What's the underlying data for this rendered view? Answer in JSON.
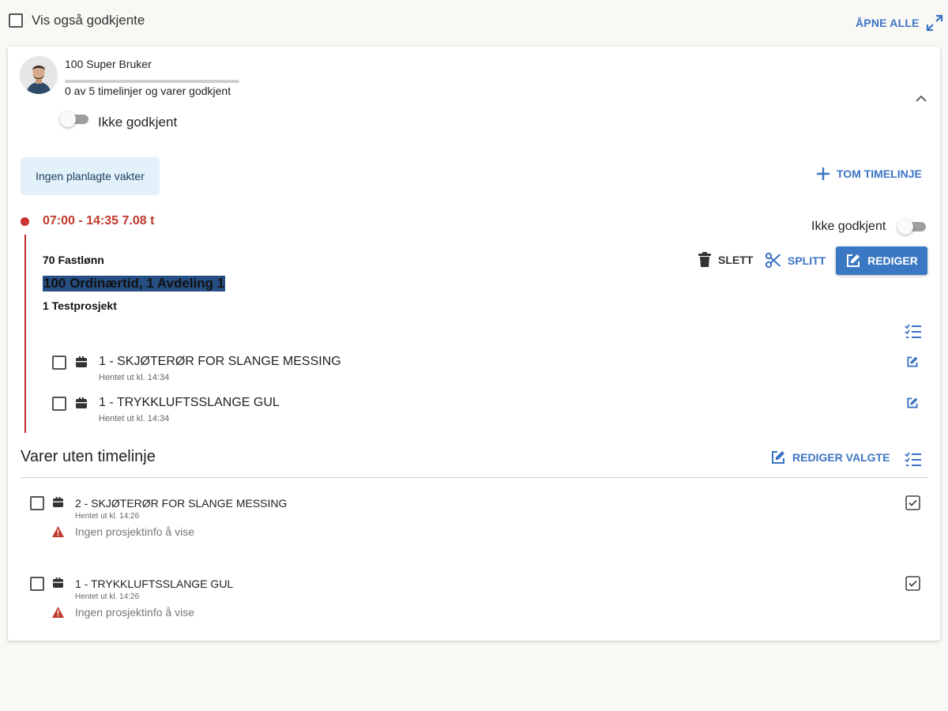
{
  "top": {
    "show_approved_label": "Vis også godkjente",
    "open_all_label": "ÅPNE ALLE"
  },
  "employee": {
    "name": "100 Super Bruker",
    "progress_text": "0 av 5 timelinjer og varer godkjent",
    "progress_fraction": 0,
    "status_label": "Ikke godkjent"
  },
  "planned": {
    "info": "Ingen planlagte vakter",
    "add_empty_line_label": "TOM TIMELINJE"
  },
  "timeline": {
    "time_range": "07:00 - 14:35 7.08 t",
    "status_label": "Ikke godkjent",
    "wage_type": "70 Fastlønn",
    "activity": "100 Ordinærtid, 1 Avdeling 1",
    "project": "1 Testprosjekt",
    "actions": {
      "delete": "SLETT",
      "split": "SPLITT",
      "edit": "REDIGER"
    },
    "items": [
      {
        "name": "1  - SKJØTERØR FOR SLANGE MESSING",
        "sub": "Hentet ut kl. 14:34"
      },
      {
        "name": "1  - TRYKKLUFTSSLANGE GUL",
        "sub": "Hentet ut kl. 14:34"
      }
    ]
  },
  "unassigned": {
    "title": "Varer uten timelinje",
    "edit_selected_label": "REDIGER VALGTE",
    "items": [
      {
        "name": "2  - SKJØTERØR FOR SLANGE MESSING",
        "sub": "Hentet ut kl. 14:26",
        "warning": "Ingen prosjektinfo å vise"
      },
      {
        "name": "1  - TRYKKLUFTSSLANGE GUL",
        "sub": "Hentet ut kl. 14:26",
        "warning": "Ingen prosjektinfo å vise"
      }
    ]
  },
  "colors": {
    "accent": "#3b74c4",
    "time_red": "#c0392b",
    "line_red": "#c62828",
    "info_bg": "#e3f1fb",
    "highlight_bg": "#264e82"
  }
}
